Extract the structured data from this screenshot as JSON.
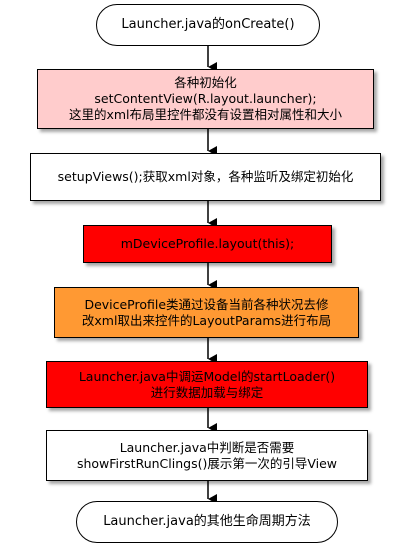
{
  "nodes": {
    "start": {
      "lines": [
        "Launcher.java的onCreate()"
      ]
    },
    "init": {
      "lines": [
        "各种初始化",
        "setContentView(R.layout.launcher);",
        "这里的xml布局里控件都没有设置相对属性和大小"
      ]
    },
    "setup_views": {
      "lines": [
        "setupViews();获取xml对象，各种监听及绑定初始化"
      ]
    },
    "device_profile": {
      "lines": [
        "mDeviceProfile.layout(this);"
      ]
    },
    "layout_params": {
      "lines": [
        "DeviceProfile类通过设备当前各种状况去修",
        "改xml取出来控件的LayoutParams进行布局"
      ]
    },
    "start_loader": {
      "lines": [
        "Launcher.java中调运Model的startLoader()",
        "进行数据加载与绑定"
      ]
    },
    "clings": {
      "lines": [
        "Launcher.java中判断是否需要",
        "showFirstRunClings()展示第一次的引导View"
      ]
    },
    "end": {
      "lines": [
        "Launcher.java的其他生命周期方法"
      ]
    }
  },
  "colors": {
    "pink": "#ffcccc",
    "red": "#ff0000",
    "orange": "#ff9933",
    "white": "#ffffff",
    "border": "#000000"
  }
}
